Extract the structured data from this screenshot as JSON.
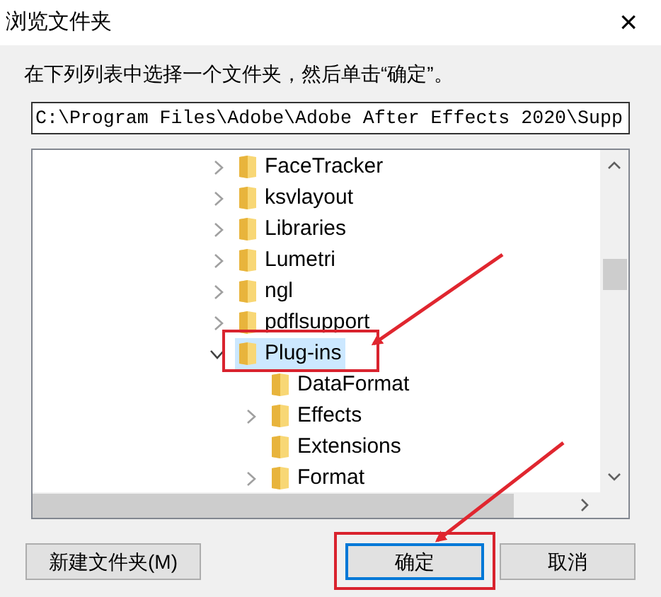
{
  "window": {
    "title": "浏览文件夹",
    "close": "×"
  },
  "instruction": "在下列列表中选择一个文件夹，然后单击“确定”。",
  "path_field": {
    "value": "C:\\Program Files\\Adobe\\Adobe After Effects 2020\\Supp"
  },
  "tree": {
    "items": [
      {
        "label": "FaceTracker",
        "kind": "expandable",
        "expanded": false,
        "selected": false
      },
      {
        "label": "ksvlayout",
        "kind": "expandable",
        "expanded": false,
        "selected": false
      },
      {
        "label": "Libraries",
        "kind": "expandable",
        "expanded": false,
        "selected": false
      },
      {
        "label": "Lumetri",
        "kind": "expandable",
        "expanded": false,
        "selected": false
      },
      {
        "label": "ngl",
        "kind": "expandable",
        "expanded": false,
        "selected": false
      },
      {
        "label": "pdflsupport",
        "kind": "expandable",
        "expanded": false,
        "selected": false
      },
      {
        "label": "Plug-ins",
        "kind": "expandable",
        "expanded": true,
        "selected": true,
        "children": [
          {
            "label": "DataFormat",
            "kind": "leaf",
            "selected": false
          },
          {
            "label": "Effects",
            "kind": "expandable",
            "expanded": false,
            "selected": false
          },
          {
            "label": "Extensions",
            "kind": "leaf",
            "selected": false
          },
          {
            "label": "Format",
            "kind": "expandable",
            "expanded": false,
            "selected": false
          }
        ]
      }
    ]
  },
  "buttons": [
    {
      "label": "新建文件夹(M)",
      "default": false
    },
    {
      "label": "确定",
      "default": true
    },
    {
      "label": "取消",
      "default": false
    }
  ]
}
